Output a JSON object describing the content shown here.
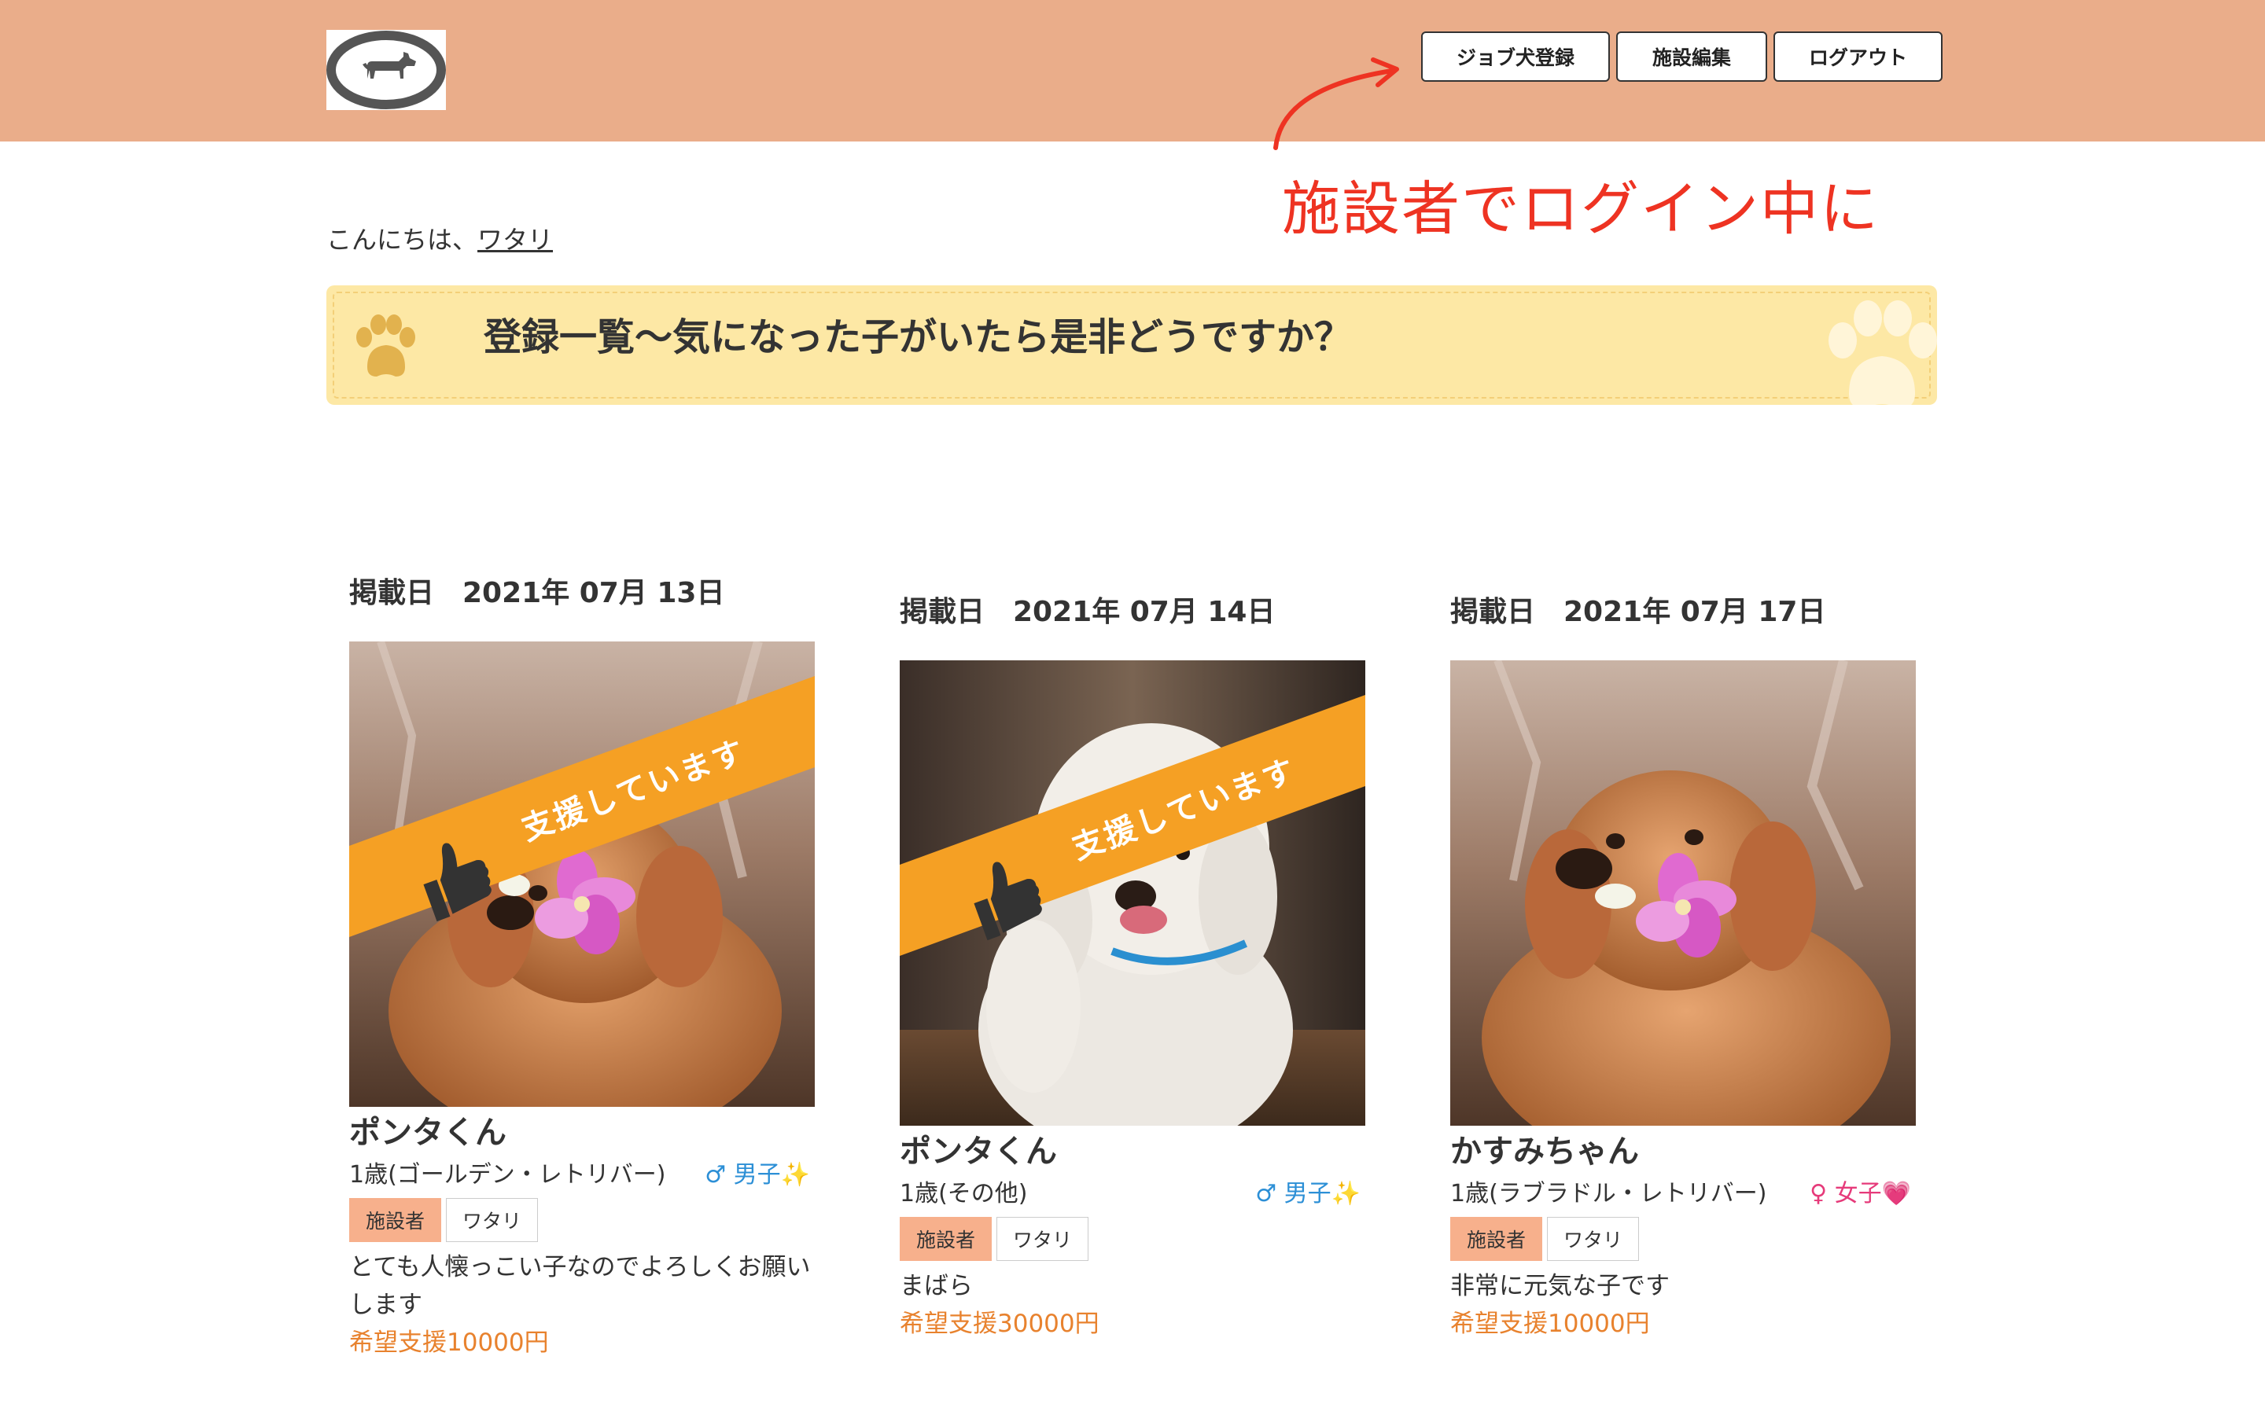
{
  "header": {
    "nav": {
      "register_dog": "ジョブ犬登録",
      "edit_facility": "施設編集",
      "logout": "ログアウト"
    },
    "logo_icon": "dog-icon"
  },
  "annotation": {
    "text": "施設者でログイン中に",
    "color": "#ee3322"
  },
  "greeting": {
    "prefix": "こんにちは、",
    "user": "ワタリ"
  },
  "banner": {
    "title": "登録一覧〜気になった子がいたら是非どうですか？",
    "icon": "paw-icon"
  },
  "cards": [
    {
      "date": "掲載日　2021年 07月 13日",
      "supported": true,
      "ribbon": "支援しています",
      "name": "ポンタくん",
      "info": "1歳(ゴールデン・レトリバー)",
      "gender": "♂ 男子✨",
      "role_tag": "施設者",
      "owner_tag": "ワタリ",
      "description": "とても人懐っこい子なのでよろしくお願いします",
      "wish": "希望支援10000円"
    },
    {
      "date": "掲載日　2021年 07月 14日",
      "supported": true,
      "ribbon": "支援しています",
      "name": "ポンタくん",
      "info": "1歳(その他)",
      "gender": "♂ 男子✨",
      "role_tag": "施設者",
      "owner_tag": "ワタリ",
      "description": "まばら",
      "wish": "希望支援30000円"
    },
    {
      "date": "掲載日　2021年 07月 17日",
      "supported": false,
      "name": "かすみちゃん",
      "info": "1歳(ラブラドル・レトリバー)",
      "gender": "♀ 女子💗",
      "role_tag": "施設者",
      "owner_tag": "ワタリ",
      "description": "非常に元気な子です",
      "wish": "希望支援10000円"
    }
  ],
  "colors": {
    "header_bg": "#eaad8a",
    "banner_bg": "#fde8a5",
    "ribbon": "#f5a024",
    "wish_text": "#e8822e",
    "male": "#2c8fd6",
    "female": "#e63a7a"
  }
}
